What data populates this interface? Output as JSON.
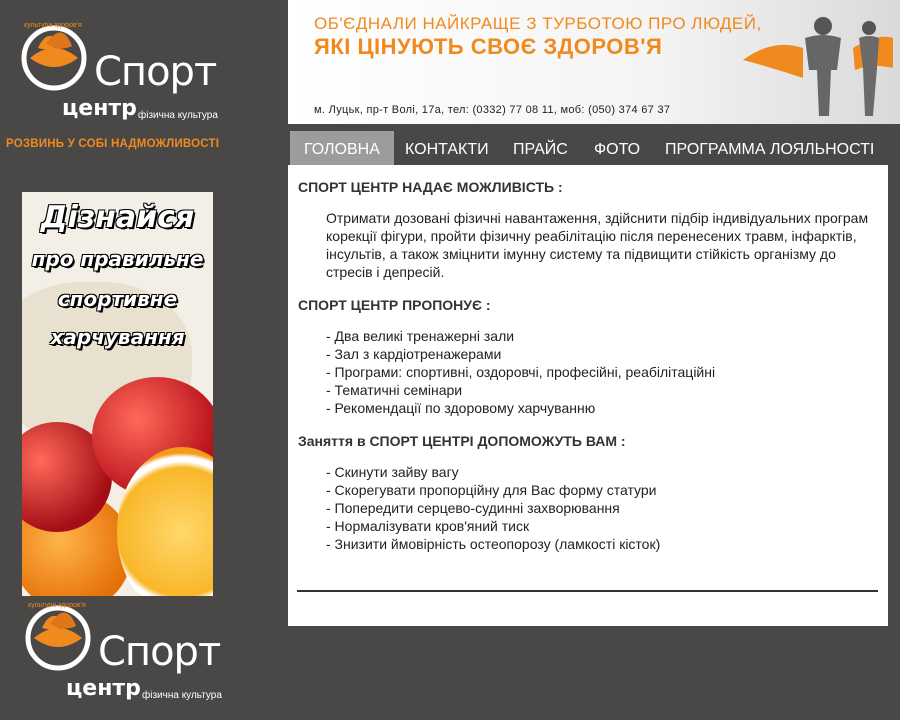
{
  "brand": {
    "word_sport": "Спорт",
    "word_center": "центр",
    "word_sub": "фізична культура",
    "arc_text": "культура здоров'я",
    "slogan": "РОЗВИНЬ У СОБІ НАДМОЖЛИВОСТІ",
    "accent_color": "#f08a1e"
  },
  "ad_banner": {
    "line1": "Дізнайся",
    "line2": "про правильне",
    "line3": "спортивне",
    "line4": "харчування"
  },
  "header": {
    "headline1": "ОБ'ЄДНАЛИ НАЙКРАЩЕ З ТУРБОТОЮ ПРО ЛЮДЕЙ,",
    "headline2": "ЯКІ ЦІНУЮТЬ СВОЄ ЗДОРОВ'Я",
    "address": "м. Луцьк, пр-т Волі, 17а, тел: (0332) 77 08 11, моб: (050) 374 67 37"
  },
  "nav": {
    "items": [
      {
        "label": "ГОЛОВНА",
        "active": true
      },
      {
        "label": "КОНТАКТИ",
        "active": false
      },
      {
        "label": "ПРАЙС",
        "active": false
      },
      {
        "label": "ФОТО",
        "active": false
      },
      {
        "label": "ПРОГРАММА ЛОЯЛЬНОСТІ",
        "active": false
      }
    ]
  },
  "content": {
    "section1_title": "СПОРТ ЦЕНТР НАДАЄ МОЖЛИВІСТЬ :",
    "section1_text": "Отримати дозовані фізичні навантаження, здійснити підбір індивідуальних програм корекції фігури, пройти фізичну реабілітацію після перенесених травм, інфарктів, інсультів, а також зміцнити імунну систему та підвищити стійкість організму до стресів і депресій.",
    "section2_title": "СПОРТ ЦЕНТР ПРОПОНУЄ :",
    "section2_items": [
      "- Два великі тренажерні зали",
      "- Зал з кардіотренажерами",
      "- Програми: спортивні, оздоровчі, професійні, реабілітаційні",
      "- Тематичні семінари",
      "- Рекомендації по здоровому харчуванню"
    ],
    "section3_title": "Заняття в СПОРТ ЦЕНТРІ ДОПОМОЖУТЬ ВАМ :",
    "section3_items": [
      "- Скинути зайву вагу",
      "- Скорегувати пропорційну для Вас форму статури",
      "- Попередити серцево-судинні захворювання",
      "- Нормалізувати кров'яний тиск",
      "- Знизити ймовірність остеопорозу (ламкості кісток)"
    ]
  }
}
